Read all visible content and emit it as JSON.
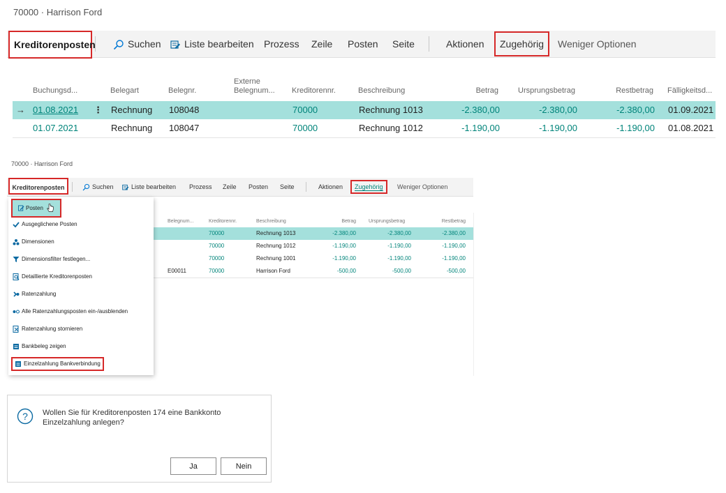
{
  "panel1": {
    "title": "70000 · Harrison Ford",
    "toolbar": {
      "tab": "Kreditorenposten",
      "search": "Suchen",
      "edit_list": "Liste bearbeiten",
      "prozess": "Prozess",
      "zeile": "Zeile",
      "posten": "Posten",
      "seite": "Seite",
      "aktionen": "Aktionen",
      "zugehoerig": "Zugehörig",
      "weniger": "Weniger Optionen"
    },
    "columns": [
      "Buchungsd...",
      "Belegart",
      "Belegnr.",
      "Externe Belegnum...",
      "Kreditorennr.",
      "Beschreibung",
      "Betrag",
      "Ursprungsbetrag",
      "Restbetrag",
      "Fälligkeitsd..."
    ],
    "col_ext_1": "Externe",
    "col_ext_2": "Belegnum...",
    "rows": [
      {
        "date": "01.08.2021",
        "type": "Rechnung",
        "no": "108048",
        "ext": "",
        "vendor": "70000",
        "desc": "Rechnung 1013",
        "amount": "-2.380,00",
        "orig": "-2.380,00",
        "rest": "-2.380,00",
        "due": "01.09.2021"
      },
      {
        "date": "01.07.2021",
        "type": "Rechnung",
        "no": "108047",
        "ext": "",
        "vendor": "70000",
        "desc": "Rechnung 1012",
        "amount": "-1.190,00",
        "orig": "-1.190,00",
        "rest": "-1.190,00",
        "due": "01.08.2021"
      }
    ]
  },
  "panel2": {
    "title": "70000 · Harrison Ford",
    "toolbar": {
      "tab": "Kreditorenposten",
      "search": "Suchen",
      "edit_list": "Liste bearbeiten",
      "prozess": "Prozess",
      "zeile": "Zeile",
      "posten": "Posten",
      "seite": "Seite",
      "aktionen": "Aktionen",
      "zugehoerig": "Zugehörig",
      "weniger": "Weniger Optionen"
    },
    "columns": [
      "Belegnum...",
      "Kreditorennr.",
      "Beschreibung",
      "Betrag",
      "Ursprungsbetrag",
      "Restbetrag"
    ],
    "rows": [
      {
        "ext": "",
        "vendor": "70000",
        "desc": "Rechnung 1013",
        "amount": "-2.380,00",
        "orig": "-2.380,00",
        "rest": "-2.380,00"
      },
      {
        "ext": "",
        "vendor": "70000",
        "desc": "Rechnung 1012",
        "amount": "-1.190,00",
        "orig": "-1.190,00",
        "rest": "-1.190,00"
      },
      {
        "ext": "",
        "vendor": "70000",
        "desc": "Rechnung 1001",
        "amount": "-1.190,00",
        "orig": "-1.190,00",
        "rest": "-1.190,00"
      },
      {
        "ext": "E00011",
        "vendor": "70000",
        "desc": "Harrison Ford",
        "amount": "-500,00",
        "orig": "-500,00",
        "rest": "-500,00"
      }
    ],
    "menu_button": "Posten",
    "menu": [
      {
        "label": "Ausgeglichene Posten",
        "icon": "check-icon"
      },
      {
        "label": "Dimensionen",
        "icon": "dimensions-icon"
      },
      {
        "label": "Dimensionsfilter festlegen...",
        "icon": "filter-icon"
      },
      {
        "label": "Detaillierte Kreditorenposten",
        "icon": "search-document-icon"
      },
      {
        "label": "Ratenzahlung",
        "icon": "installment-icon"
      },
      {
        "label": "Alle Ratenzahlungsposten ein-/ausblenden",
        "icon": "toggle-icon"
      },
      {
        "label": "Ratenzahlung stornieren",
        "icon": "cancel-installment-icon"
      },
      {
        "label": "Bankbeleg zeigen",
        "icon": "bank-document-icon"
      },
      {
        "label": "Einzelzahlung Bankverbindung",
        "icon": "bank-payment-icon"
      }
    ]
  },
  "dialog": {
    "line1": "Wollen Sie für Kreditorenposten 174 eine Bankkonto",
    "line2": "Einzelzahlung anlegen?",
    "yes": "Ja",
    "no": "Nein"
  },
  "colors": {
    "accent": "#00847a",
    "selected_row": "#a4e0dc",
    "highlight_box": "#d62828",
    "toolbar_bg": "#f3f3f3"
  }
}
